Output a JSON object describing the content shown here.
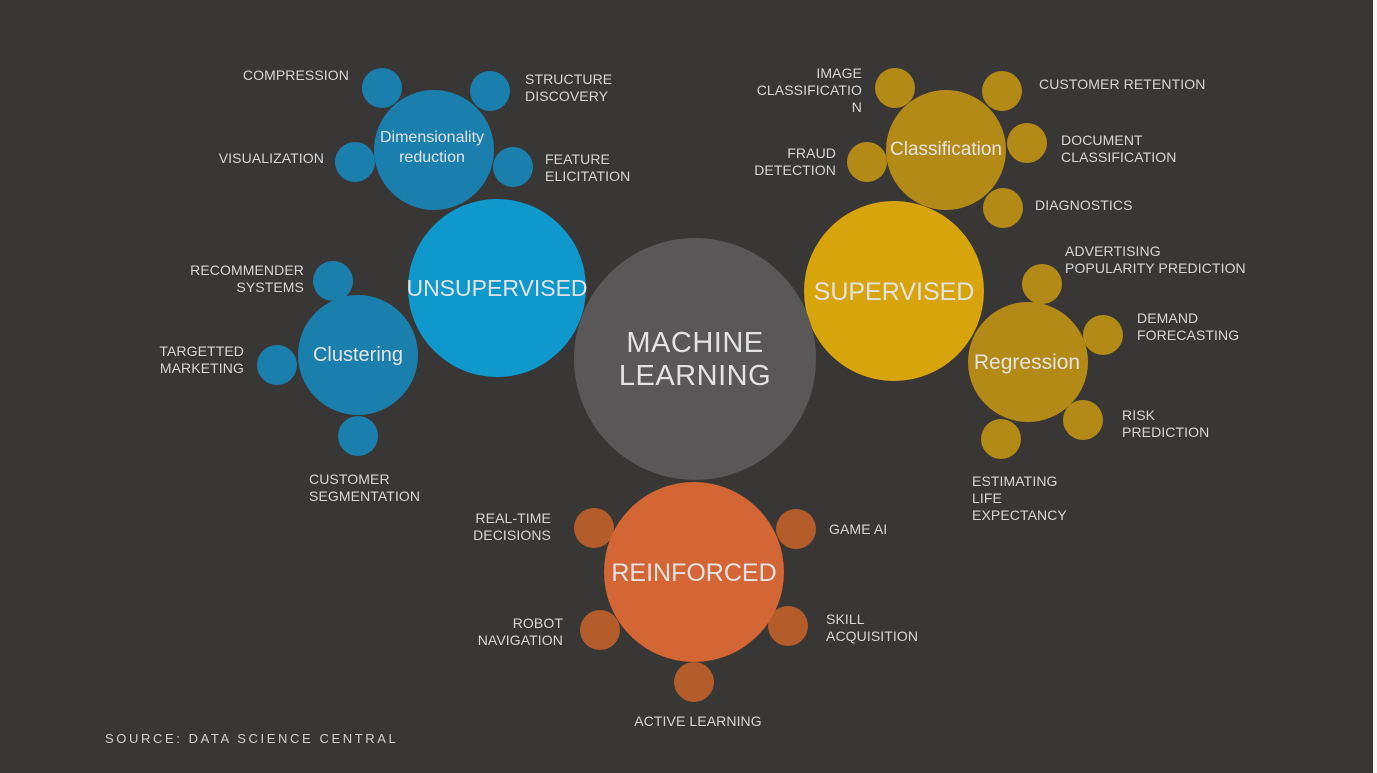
{
  "center": {
    "label": "MACHINE\nLEARNING"
  },
  "colors": {
    "background": "#393736",
    "center": "#595757",
    "unsupervised_main": "#0f98cc",
    "unsupervised_sub": "#1a7fac",
    "supervised_main": "#d8a40c",
    "supervised_sub": "#b48a17",
    "reinforced_main": "#d46535",
    "reinforced_leaf": "#b45c2a"
  },
  "unsupervised": {
    "label": "UNSUPERVISED",
    "dimensionality_reduction": {
      "label": "Dimensionality\nreduction",
      "items": {
        "compression": "COMPRESSION",
        "structure_discovery": "STRUCTURE\nDISCOVERY",
        "visualization": "VISUALIZATION",
        "feature_elicitation": "FEATURE\nELICITATION"
      }
    },
    "clustering": {
      "label": "Clustering",
      "items": {
        "recommender_systems": "RECOMMENDER\nSYSTEMS",
        "targetted_marketing": "TARGETTED\nMARKETING",
        "customer_segmentation": "CUSTOMER\nSEGMENTATION"
      }
    }
  },
  "supervised": {
    "label": "SUPERVISED",
    "classification": {
      "label": "Classification",
      "items": {
        "image_classification": "IMAGE\nCLASSIFICATIO\nN",
        "customer_retention": "CUSTOMER RETENTION",
        "fraud_detection": "FRAUD\nDETECTION",
        "document_classification": "DOCUMENT\nCLASSIFICATION",
        "diagnostics": "DIAGNOSTICS"
      }
    },
    "regression": {
      "label": "Regression",
      "items": {
        "advertising_popularity_prediction": "ADVERTISING\nPOPULARITY PREDICTION",
        "demand_forecasting": "DEMAND\nFORECASTING",
        "risk_prediction": "RISK\nPREDICTION",
        "estimating_life_expectancy": "ESTIMATING\nLIFE\nEXPECTANCY"
      }
    }
  },
  "reinforced": {
    "label": "REINFORCED",
    "items": {
      "real_time_decisions": "REAL-TIME\nDECISIONS",
      "game_ai": "GAME AI",
      "robot_navigation": "ROBOT\nNAVIGATION",
      "skill_acquisition": "SKILL\nACQUISITION",
      "active_learning": "ACTIVE LEARNING"
    }
  },
  "source": "SOURCE: DATA SCIENCE CENTRAL"
}
